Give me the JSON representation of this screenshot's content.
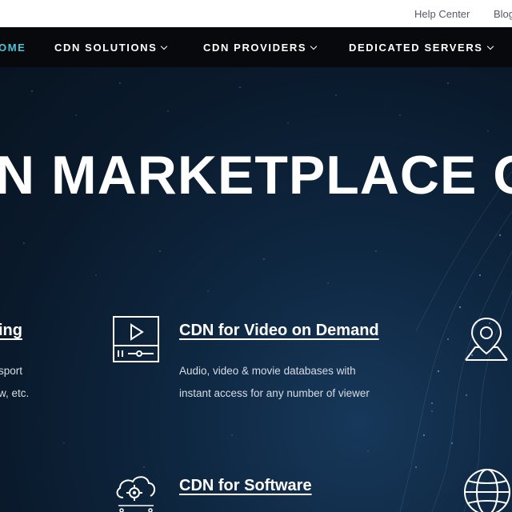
{
  "topbar": {
    "help_center": "Help Center",
    "blog": "Blog"
  },
  "nav": {
    "home": "OME",
    "cdn_solutions": "CDN SOLUTIONS",
    "cdn_providers": "CDN PROVIDERS",
    "dedicated_servers": "DEDICATED SERVERS"
  },
  "hero": {
    "title": "N MARKETPLACE ON"
  },
  "services": {
    "left": {
      "title": "ing",
      "desc_line1": "sport",
      "desc_line2": "w, etc."
    },
    "video": {
      "title": "CDN for Video on Demand",
      "desc_line1": "Audio, video & movie databases with",
      "desc_line2": "instant access for any number of viewer",
      "icon": "video-player-icon"
    },
    "software": {
      "title": "CDN for Software",
      "icon": "cloud-gear-icon"
    },
    "right_icons": [
      "map-pin-icon",
      "globe-icon"
    ]
  },
  "colors": {
    "nav_bg": "#07090c",
    "active_nav": "#4fc6d8",
    "hero_bg": "#0e2741"
  }
}
